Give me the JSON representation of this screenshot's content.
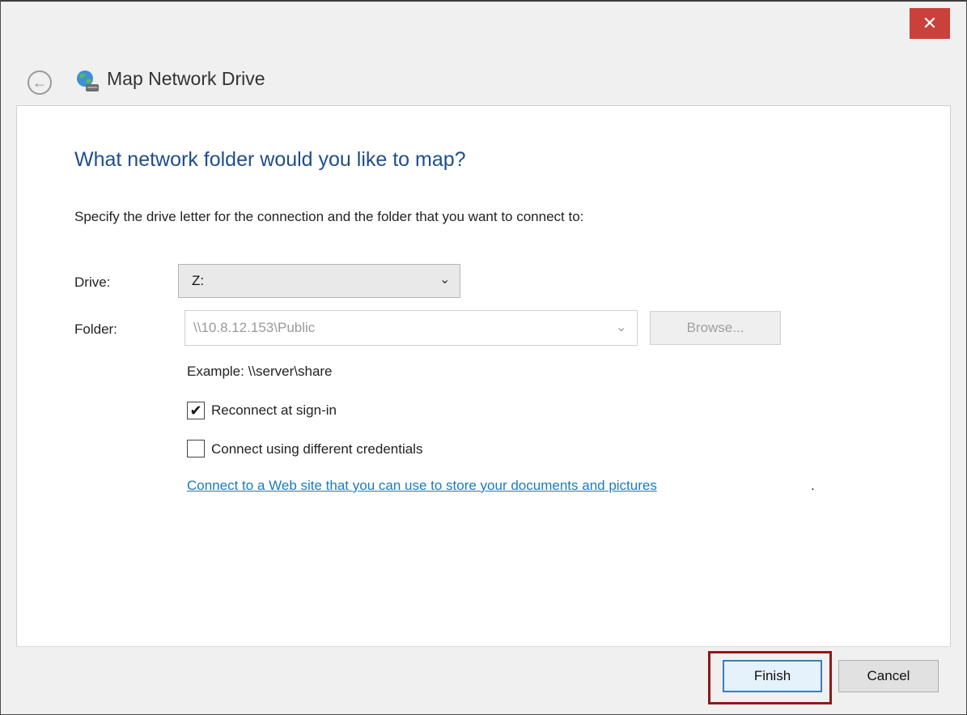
{
  "window": {
    "title": "Map Network Drive",
    "close_glyph": "✕"
  },
  "nav": {
    "back_glyph": "←"
  },
  "icons": {
    "app": "network-drive-globe-icon"
  },
  "main": {
    "heading": "What network folder would you like to map?",
    "instruction": "Specify the drive letter for the connection and the folder that you want to connect to:"
  },
  "form": {
    "drive_label": "Drive:",
    "drive_value": "Z:",
    "folder_label": "Folder:",
    "folder_value": "\\\\10.8.12.153\\Public",
    "browse_label": "Browse...",
    "example": "Example: \\\\server\\share",
    "reconnect_label": "Reconnect at sign-in",
    "reconnect_checked": true,
    "credentials_label": "Connect using different credentials",
    "credentials_checked": false,
    "checkmark_glyph": "✔",
    "link_text": "Connect to a Web site that you can use to store your documents and pictures",
    "link_period": ".",
    "chevron_glyph": "⌄"
  },
  "footer": {
    "finish_label": "Finish",
    "cancel_label": "Cancel"
  },
  "colors": {
    "heading": "#1f4e8c",
    "link": "#1a7bbf",
    "close": "#c9413a",
    "highlight": "#8b1a1a"
  }
}
